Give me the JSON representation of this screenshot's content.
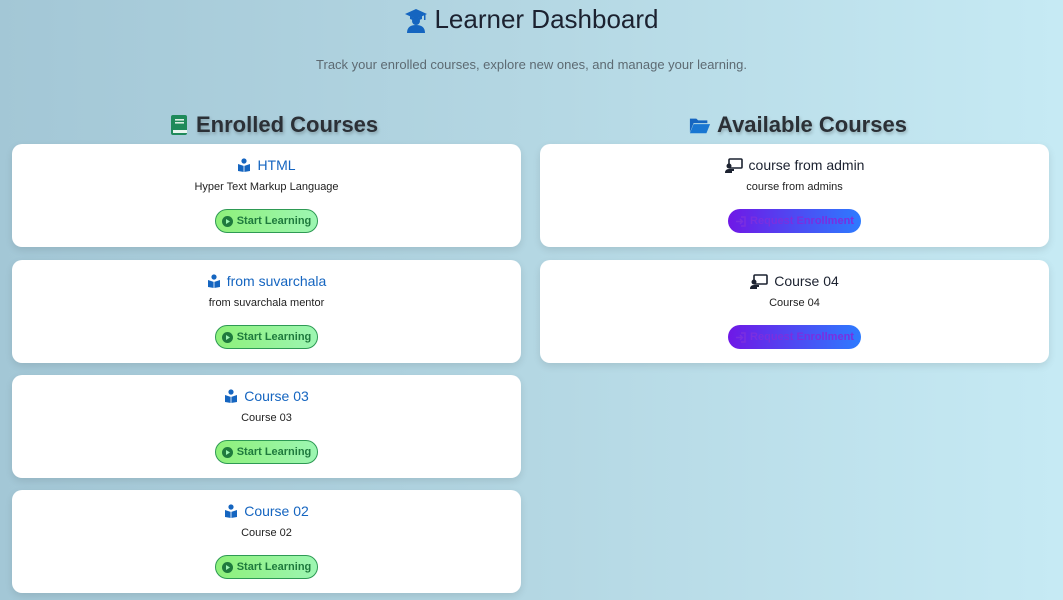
{
  "header": {
    "title": "Learner Dashboard",
    "title_icon": "graduate-icon",
    "subtitle": "Track your enrolled courses, explore new ones, and manage your learning."
  },
  "enrolled": {
    "title": "Enrolled Courses",
    "icon": "book-icon",
    "courses": [
      {
        "name": "HTML",
        "description": "Hyper Text Markup Language",
        "button": "Start Learning"
      },
      {
        "name": "from suvarchala",
        "description": "from suvarchala mentor",
        "button": "Start Learning"
      },
      {
        "name": "Course 03",
        "description": "Course 03",
        "button": "Start Learning"
      },
      {
        "name": "Course 02",
        "description": "Course 02",
        "button": "Start Learning"
      }
    ]
  },
  "available": {
    "title": "Available Courses",
    "icon": "folder-open-icon",
    "courses": [
      {
        "name": "course from admin",
        "description": "course from admins",
        "button": "Request Enrollment"
      },
      {
        "name": "Course 04",
        "description": "Course 04",
        "button": "Request Enrollment"
      }
    ]
  },
  "colors": {
    "enrolled_title": "#1565c0",
    "start_button_bg": "#8ef07a",
    "start_button_text": "#1f7a3d",
    "request_button_bg_start": "#6f18e6",
    "request_button_bg_end": "#2d7bff"
  }
}
